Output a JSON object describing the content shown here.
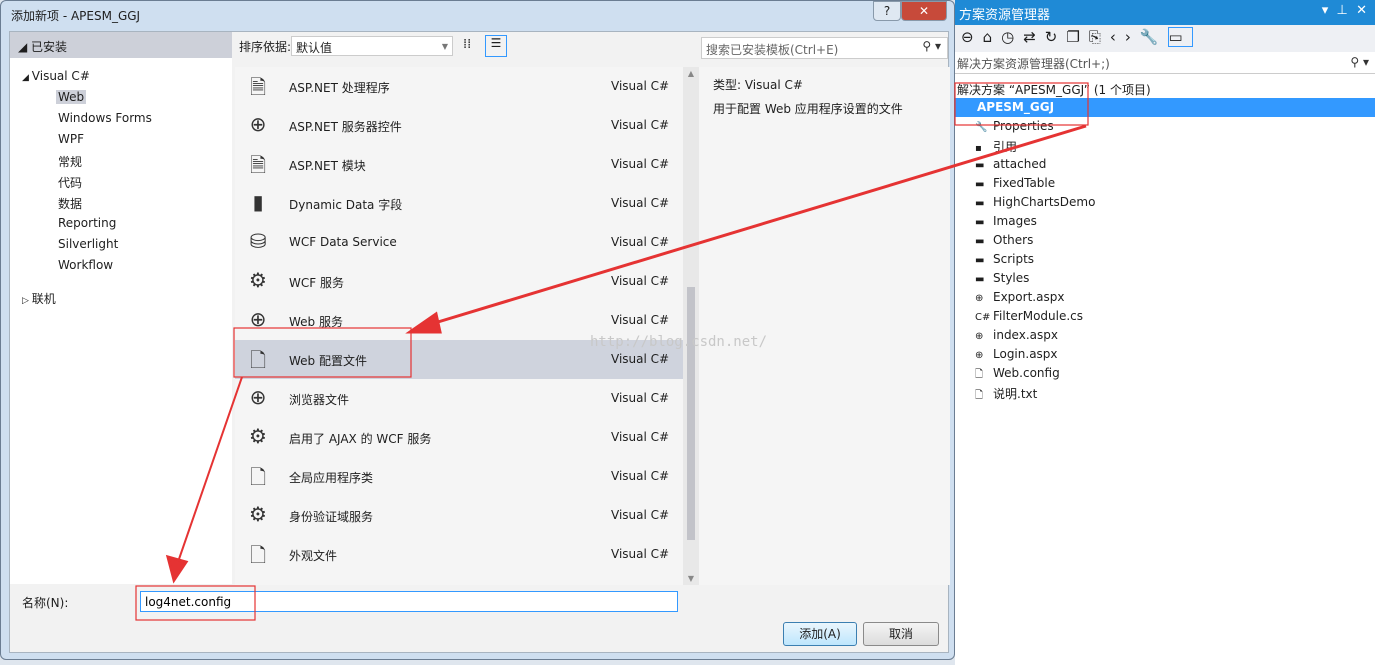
{
  "dialog": {
    "title": "添加新项 - APESM_GGJ",
    "help": "?",
    "close": "✕"
  },
  "left": {
    "installed": "已安装",
    "lang": "Visual C#",
    "items": [
      "Web",
      "Windows Forms",
      "WPF",
      "常规",
      "代码",
      "数据",
      "Reporting",
      "Silverlight",
      "Workflow"
    ],
    "online": "联机"
  },
  "sort": {
    "label": "排序依据:",
    "value": "默认值"
  },
  "search": {
    "placeholder": "搜索已安装模板(Ctrl+E)"
  },
  "templates": [
    {
      "name": "ASP.NET 处理程序",
      "lang": "Visual C#",
      "icon": "handler-icon"
    },
    {
      "name": "ASP.NET 服务器控件",
      "lang": "Visual C#",
      "icon": "server-control-icon"
    },
    {
      "name": "ASP.NET 模块",
      "lang": "Visual C#",
      "icon": "module-icon"
    },
    {
      "name": "Dynamic Data 字段",
      "lang": "Visual C#",
      "icon": "dynamic-data-icon"
    },
    {
      "name": "WCF Data Service",
      "lang": "Visual C#",
      "icon": "data-service-icon"
    },
    {
      "name": "WCF 服务",
      "lang": "Visual C#",
      "icon": "wcf-icon"
    },
    {
      "name": "Web 服务",
      "lang": "Visual C#",
      "icon": "web-service-icon"
    },
    {
      "name": "Web 配置文件",
      "lang": "Visual C#",
      "icon": "config-icon"
    },
    {
      "name": "浏览器文件",
      "lang": "Visual C#",
      "icon": "browser-icon"
    },
    {
      "name": "启用了 AJAX 的 WCF 服务",
      "lang": "Visual C#",
      "icon": "wcf-icon"
    },
    {
      "name": "全局应用程序类",
      "lang": "Visual C#",
      "icon": "global-icon"
    },
    {
      "name": "身份验证域服务",
      "lang": "Visual C#",
      "icon": "wcf-icon"
    },
    {
      "name": "外观文件",
      "lang": "Visual C#",
      "icon": "skin-icon"
    }
  ],
  "details": {
    "type": "类型:  Visual C#",
    "desc": "用于配置 Web 应用程序设置的文件"
  },
  "name_field": {
    "label": "名称(N):",
    "value": "log4net.config"
  },
  "buttons": {
    "add": "添加(A)",
    "cancel": "取消"
  },
  "watermark": "http://blog.csdn.net/",
  "solution_explorer": {
    "title": "方案资源管理器",
    "search": "解决方案资源管理器(Ctrl+;)",
    "solution": "解决方案 “APESM_GGJ” (1 个项目)",
    "project": "APESM_GGJ",
    "items": [
      "Properties",
      "引用",
      "attached",
      "FixedTable",
      "HighChartsDemo",
      "Images",
      "Others",
      "Scripts",
      "Styles",
      "Export.aspx",
      "FilterModule.cs",
      "index.aspx",
      "Login.aspx",
      "Web.config",
      "说明.txt"
    ]
  },
  "colors": {
    "accent": "#1f8ad6",
    "annotation": "#e53333"
  }
}
